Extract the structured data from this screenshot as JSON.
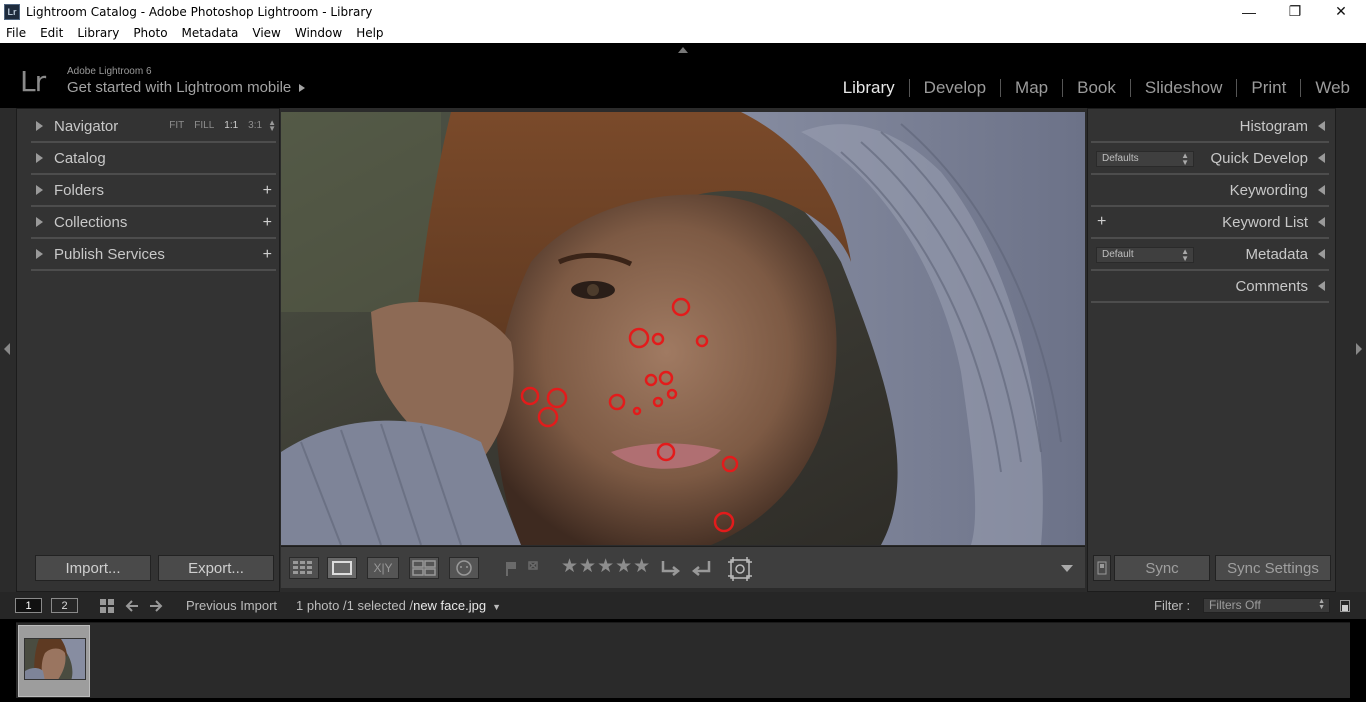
{
  "window": {
    "title": "Lightroom Catalog - Adobe Photoshop Lightroom - Library",
    "app_icon_text": "Lr",
    "controls": {
      "minimize": "—",
      "maximize": "❐",
      "close": "✕"
    }
  },
  "menubar": {
    "items": [
      "File",
      "Edit",
      "Library",
      "Photo",
      "Metadata",
      "View",
      "Window",
      "Help"
    ]
  },
  "identity": {
    "logo": "Lr",
    "product": "Adobe Lightroom 6",
    "mobile_prompt": "Get started with Lightroom mobile"
  },
  "modules": {
    "items": [
      "Library",
      "Develop",
      "Map",
      "Book",
      "Slideshow",
      "Print",
      "Web"
    ],
    "active": "Library"
  },
  "left_panel": {
    "navigator": {
      "label": "Navigator",
      "options": [
        "FIT",
        "FILL",
        "1:1",
        "3:1"
      ],
      "current": "1:1"
    },
    "sections": [
      "Catalog",
      "Folders",
      "Collections",
      "Publish Services"
    ],
    "import_label": "Import...",
    "export_label": "Export..."
  },
  "toolbar": {
    "xy_label": "X|Y",
    "stars": "★★★★★"
  },
  "right_panel": {
    "sections": {
      "histogram": "Histogram",
      "quick_develop": "Quick Develop",
      "quick_develop_preset": "Defaults",
      "keywording": "Keywording",
      "keyword_list": "Keyword List",
      "metadata": "Metadata",
      "metadata_preset": "Default",
      "comments": "Comments"
    },
    "sync_label": "Sync",
    "sync_settings_label": "Sync Settings"
  },
  "filmstrip_bar": {
    "monitor1": "1",
    "monitor2": "2",
    "source": "Previous Import",
    "count_text": "1 photo /1 selected /",
    "filename": "new face.jpg",
    "filter_label": "Filter :",
    "filter_value": "Filters Off"
  },
  "colors": {
    "accent_red": "#e31b1b",
    "panel_bg": "#333333",
    "background": "#000000"
  }
}
